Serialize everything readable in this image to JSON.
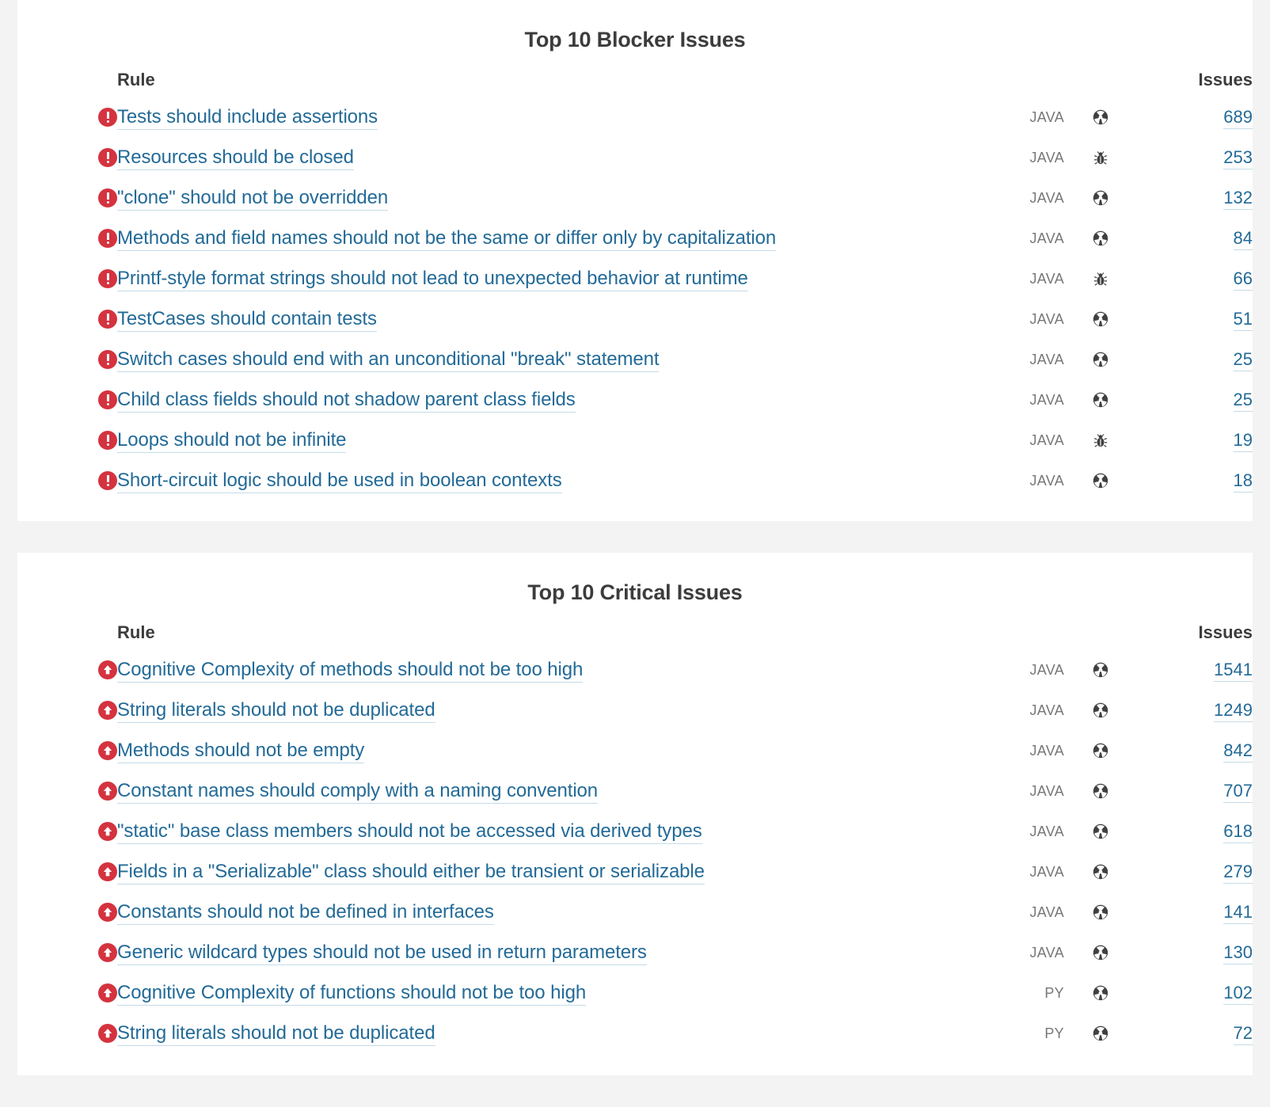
{
  "colors": {
    "page_background": "#f3f3f3",
    "panel_background": "#ffffff",
    "link": "#236a97",
    "link_underline": "#c5dbe8",
    "heading": "#3c3c3c",
    "severity_red": "#d4333f",
    "type_icon": "#404040",
    "language_text": "#777777"
  },
  "panels": [
    {
      "title": "Top 10 Blocker Issues",
      "columns": {
        "severity": "",
        "rule": "Rule",
        "language": "",
        "type": "",
        "issues": "Issues"
      },
      "rows": [
        {
          "severity_icon": "blocker-icon",
          "rule": "Tests should include assertions",
          "language": "JAVA",
          "type_icon": "code-smell-icon",
          "issues": "689"
        },
        {
          "severity_icon": "blocker-icon",
          "rule": "Resources should be closed",
          "language": "JAVA",
          "type_icon": "bug-icon",
          "issues": "253"
        },
        {
          "severity_icon": "blocker-icon",
          "rule": "\"clone\" should not be overridden",
          "language": "JAVA",
          "type_icon": "code-smell-icon",
          "issues": "132"
        },
        {
          "severity_icon": "blocker-icon",
          "rule": "Methods and field names should not be the same or differ only by capitalization",
          "language": "JAVA",
          "type_icon": "code-smell-icon",
          "issues": "84"
        },
        {
          "severity_icon": "blocker-icon",
          "rule": "Printf-style format strings should not lead to unexpected behavior at runtime",
          "language": "JAVA",
          "type_icon": "bug-icon",
          "issues": "66"
        },
        {
          "severity_icon": "blocker-icon",
          "rule": "TestCases should contain tests",
          "language": "JAVA",
          "type_icon": "code-smell-icon",
          "issues": "51"
        },
        {
          "severity_icon": "blocker-icon",
          "rule": "Switch cases should end with an unconditional \"break\" statement",
          "language": "JAVA",
          "type_icon": "code-smell-icon",
          "issues": "25"
        },
        {
          "severity_icon": "blocker-icon",
          "rule": "Child class fields should not shadow parent class fields",
          "language": "JAVA",
          "type_icon": "code-smell-icon",
          "issues": "25"
        },
        {
          "severity_icon": "blocker-icon",
          "rule": "Loops should not be infinite",
          "language": "JAVA",
          "type_icon": "bug-icon",
          "issues": "19"
        },
        {
          "severity_icon": "blocker-icon",
          "rule": "Short-circuit logic should be used in boolean contexts",
          "language": "JAVA",
          "type_icon": "code-smell-icon",
          "issues": "18"
        }
      ]
    },
    {
      "title": "Top 10 Critical Issues",
      "columns": {
        "severity": "",
        "rule": "Rule",
        "language": "",
        "type": "",
        "issues": "Issues"
      },
      "rows": [
        {
          "severity_icon": "critical-icon",
          "rule": "Cognitive Complexity of methods should not be too high",
          "language": "JAVA",
          "type_icon": "code-smell-icon",
          "issues": "1541"
        },
        {
          "severity_icon": "critical-icon",
          "rule": "String literals should not be duplicated",
          "language": "JAVA",
          "type_icon": "code-smell-icon",
          "issues": "1249"
        },
        {
          "severity_icon": "critical-icon",
          "rule": "Methods should not be empty",
          "language": "JAVA",
          "type_icon": "code-smell-icon",
          "issues": "842"
        },
        {
          "severity_icon": "critical-icon",
          "rule": "Constant names should comply with a naming convention",
          "language": "JAVA",
          "type_icon": "code-smell-icon",
          "issues": "707"
        },
        {
          "severity_icon": "critical-icon",
          "rule": "\"static\" base class members should not be accessed via derived types",
          "language": "JAVA",
          "type_icon": "code-smell-icon",
          "issues": "618"
        },
        {
          "severity_icon": "critical-icon",
          "rule": "Fields in a \"Serializable\" class should either be transient or serializable",
          "language": "JAVA",
          "type_icon": "code-smell-icon",
          "issues": "279"
        },
        {
          "severity_icon": "critical-icon",
          "rule": "Constants should not be defined in interfaces",
          "language": "JAVA",
          "type_icon": "code-smell-icon",
          "issues": "141"
        },
        {
          "severity_icon": "critical-icon",
          "rule": "Generic wildcard types should not be used in return parameters",
          "language": "JAVA",
          "type_icon": "code-smell-icon",
          "issues": "130"
        },
        {
          "severity_icon": "critical-icon",
          "rule": "Cognitive Complexity of functions should not be too high",
          "language": "PY",
          "type_icon": "code-smell-icon",
          "issues": "102"
        },
        {
          "severity_icon": "critical-icon",
          "rule": "String literals should not be duplicated",
          "language": "PY",
          "type_icon": "code-smell-icon",
          "issues": "72"
        }
      ]
    }
  ]
}
